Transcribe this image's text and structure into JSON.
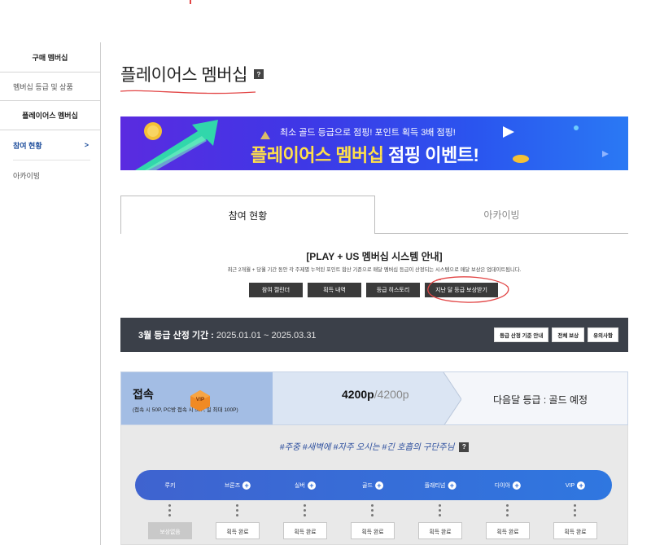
{
  "sidebar": {
    "header_purchase": "구매 멤버십",
    "link_grade_goods": "멤버십 등급 및 상품",
    "header_places": "플레이어스 멤버십",
    "active_item": "참여 현황",
    "active_chevron": ">",
    "link_archive": "아카이빙"
  },
  "page": {
    "title": "플레이어스 멤버십",
    "help": "?"
  },
  "banner": {
    "top_text": "최소 골드 등급으로 점핑! 포인트 획득 3배 점핑!",
    "main_highlight": "플레이어스 멤버십",
    "main_rest": " 점핑 이벤트!"
  },
  "tabs": {
    "participation": "참여 현황",
    "archive": "아카이빙"
  },
  "guide": {
    "title": "[PLAY + US 멤버십 시스템 안내]",
    "desc": "최근 2개월 + 당월 기간 동안 각 주제별 누적된 포인트 합산 기준으로 매달 멤버십 등급이 산정되는 시스템으로 매달 보상은 업데이트됩니다.",
    "buttons": [
      "참여 캘린더",
      "획득 내역",
      "등급 히스토리",
      "지난 달 등급 보상받기"
    ]
  },
  "period": {
    "label": "3월 등급 산정 기간 : ",
    "dates": "2025.01.01 ~ 2025.03.31",
    "buttons": [
      "등급 산정 기준 안내",
      "전체 보상",
      "유의사항"
    ]
  },
  "status": {
    "name": "접속",
    "note": "(접속 시 50P, PC방 접속 시 50P, 일 최대 100P)",
    "badge": "VIP",
    "points": "4200p",
    "points_total": "/4200p",
    "next": "다음달 등급 : 골드 예정"
  },
  "hashtags": {
    "text": "#주중 #새벽에 #자주 오시는 #긴 호흡의 구단주님",
    "help": "?"
  },
  "grades": [
    {
      "label": "루키",
      "plus": false,
      "reward": "보상없음",
      "reward_disabled": true
    },
    {
      "label": "브론즈",
      "plus": true,
      "reward": "획득 완료",
      "reward_disabled": false
    },
    {
      "label": "실버",
      "plus": true,
      "reward": "획득 완료",
      "reward_disabled": false
    },
    {
      "label": "골드",
      "plus": true,
      "reward": "획득 완료",
      "reward_disabled": false
    },
    {
      "label": "플래티넘",
      "plus": true,
      "reward": "획득 완료",
      "reward_disabled": false
    },
    {
      "label": "다이아",
      "plus": true,
      "reward": "획득 완료",
      "reward_disabled": false
    },
    {
      "label": "VIP",
      "plus": true,
      "reward": "획득 완료",
      "reward_disabled": false
    }
  ],
  "colors": {
    "accent_blue": "#1f4e9c",
    "dark_bar": "#3b4049",
    "annotation_red": "#e24545",
    "banner_yellow": "#ffe04a"
  }
}
